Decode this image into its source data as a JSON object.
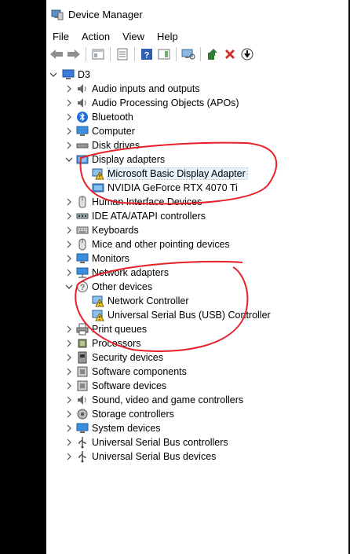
{
  "window": {
    "title": "Device Manager"
  },
  "menu": [
    "File",
    "Action",
    "View",
    "Help"
  ],
  "toolbar": {
    "icons": [
      "back-arrow-icon",
      "forward-arrow-icon",
      "properties-icon",
      "list-view-icon",
      "help-icon",
      "action-pane-icon",
      "scan-hardware-icon",
      "update-driver-icon",
      "uninstall-icon",
      "download-icon"
    ]
  },
  "tree": {
    "root": "D3",
    "categories": [
      {
        "label": "Audio inputs and outputs",
        "icon": "speaker-icon",
        "expanded": false
      },
      {
        "label": "Audio Processing Objects (APOs)",
        "icon": "speaker-icon",
        "expanded": false
      },
      {
        "label": "Bluetooth",
        "icon": "bluetooth-icon",
        "expanded": false
      },
      {
        "label": "Computer",
        "icon": "monitor-icon",
        "expanded": false
      },
      {
        "label": "Disk drives",
        "icon": "disk-icon",
        "expanded": false
      },
      {
        "label": "Display adapters",
        "icon": "display-adapter-icon",
        "expanded": true,
        "children": [
          {
            "label": "Microsoft Basic Display Adapter",
            "icon": "warning-icon",
            "selected": true
          },
          {
            "label": "NVIDIA GeForce RTX 4070 Ti",
            "icon": "display-adapter-icon"
          }
        ]
      },
      {
        "label": "Human Interface Devices",
        "icon": "hid-icon",
        "expanded": false
      },
      {
        "label": "IDE ATA/ATAPI controllers",
        "icon": "ide-icon",
        "expanded": false
      },
      {
        "label": "Keyboards",
        "icon": "keyboard-icon",
        "expanded": false
      },
      {
        "label": "Mice and other pointing devices",
        "icon": "mouse-icon",
        "expanded": false
      },
      {
        "label": "Monitors",
        "icon": "monitor-icon",
        "expanded": false
      },
      {
        "label": "Network adapters",
        "icon": "network-icon",
        "expanded": false
      },
      {
        "label": "Other devices",
        "icon": "unknown-device-icon",
        "expanded": true,
        "children": [
          {
            "label": "Network Controller",
            "icon": "warning-icon"
          },
          {
            "label": "Universal Serial Bus (USB) Controller",
            "icon": "warning-icon"
          }
        ]
      },
      {
        "label": "Print queues",
        "icon": "printer-icon",
        "expanded": false
      },
      {
        "label": "Processors",
        "icon": "chip-icon",
        "expanded": false
      },
      {
        "label": "Security devices",
        "icon": "security-icon",
        "expanded": false
      },
      {
        "label": "Software components",
        "icon": "component-icon",
        "expanded": false
      },
      {
        "label": "Software devices",
        "icon": "component-icon",
        "expanded": false
      },
      {
        "label": "Sound, video and game controllers",
        "icon": "speaker-icon",
        "expanded": false
      },
      {
        "label": "Storage controllers",
        "icon": "storage-icon",
        "expanded": false
      },
      {
        "label": "System devices",
        "icon": "monitor-icon",
        "expanded": false
      },
      {
        "label": "Universal Serial Bus controllers",
        "icon": "usb-icon",
        "expanded": false
      },
      {
        "label": "Universal Serial Bus devices",
        "icon": "usb-icon",
        "expanded": false
      }
    ]
  },
  "colors": {
    "annotation": "#e8202a",
    "selection": "#e5f1fb",
    "accent": "#1e88e5"
  }
}
